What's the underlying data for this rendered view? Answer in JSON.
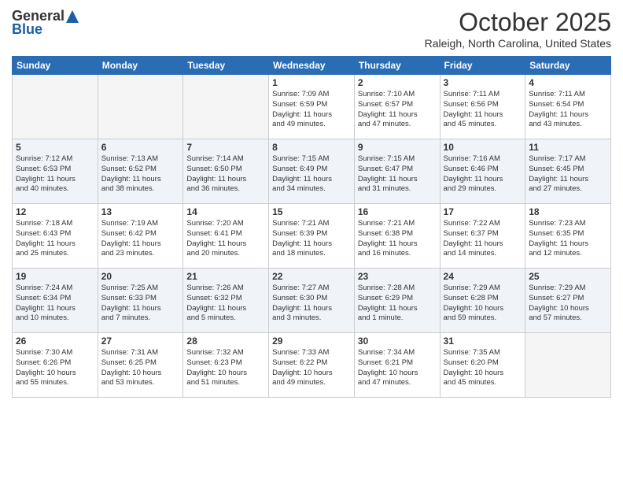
{
  "header": {
    "logo_general": "General",
    "logo_blue": "Blue",
    "month_title": "October 2025",
    "subtitle": "Raleigh, North Carolina, United States"
  },
  "days": [
    "Sunday",
    "Monday",
    "Tuesday",
    "Wednesday",
    "Thursday",
    "Friday",
    "Saturday"
  ],
  "weeks": [
    [
      {
        "date": "",
        "info": ""
      },
      {
        "date": "",
        "info": ""
      },
      {
        "date": "",
        "info": ""
      },
      {
        "date": "1",
        "info": "Sunrise: 7:09 AM\nSunset: 6:59 PM\nDaylight: 11 hours\nand 49 minutes."
      },
      {
        "date": "2",
        "info": "Sunrise: 7:10 AM\nSunset: 6:57 PM\nDaylight: 11 hours\nand 47 minutes."
      },
      {
        "date": "3",
        "info": "Sunrise: 7:11 AM\nSunset: 6:56 PM\nDaylight: 11 hours\nand 45 minutes."
      },
      {
        "date": "4",
        "info": "Sunrise: 7:11 AM\nSunset: 6:54 PM\nDaylight: 11 hours\nand 43 minutes."
      }
    ],
    [
      {
        "date": "5",
        "info": "Sunrise: 7:12 AM\nSunset: 6:53 PM\nDaylight: 11 hours\nand 40 minutes."
      },
      {
        "date": "6",
        "info": "Sunrise: 7:13 AM\nSunset: 6:52 PM\nDaylight: 11 hours\nand 38 minutes."
      },
      {
        "date": "7",
        "info": "Sunrise: 7:14 AM\nSunset: 6:50 PM\nDaylight: 11 hours\nand 36 minutes."
      },
      {
        "date": "8",
        "info": "Sunrise: 7:15 AM\nSunset: 6:49 PM\nDaylight: 11 hours\nand 34 minutes."
      },
      {
        "date": "9",
        "info": "Sunrise: 7:15 AM\nSunset: 6:47 PM\nDaylight: 11 hours\nand 31 minutes."
      },
      {
        "date": "10",
        "info": "Sunrise: 7:16 AM\nSunset: 6:46 PM\nDaylight: 11 hours\nand 29 minutes."
      },
      {
        "date": "11",
        "info": "Sunrise: 7:17 AM\nSunset: 6:45 PM\nDaylight: 11 hours\nand 27 minutes."
      }
    ],
    [
      {
        "date": "12",
        "info": "Sunrise: 7:18 AM\nSunset: 6:43 PM\nDaylight: 11 hours\nand 25 minutes."
      },
      {
        "date": "13",
        "info": "Sunrise: 7:19 AM\nSunset: 6:42 PM\nDaylight: 11 hours\nand 23 minutes."
      },
      {
        "date": "14",
        "info": "Sunrise: 7:20 AM\nSunset: 6:41 PM\nDaylight: 11 hours\nand 20 minutes."
      },
      {
        "date": "15",
        "info": "Sunrise: 7:21 AM\nSunset: 6:39 PM\nDaylight: 11 hours\nand 18 minutes."
      },
      {
        "date": "16",
        "info": "Sunrise: 7:21 AM\nSunset: 6:38 PM\nDaylight: 11 hours\nand 16 minutes."
      },
      {
        "date": "17",
        "info": "Sunrise: 7:22 AM\nSunset: 6:37 PM\nDaylight: 11 hours\nand 14 minutes."
      },
      {
        "date": "18",
        "info": "Sunrise: 7:23 AM\nSunset: 6:35 PM\nDaylight: 11 hours\nand 12 minutes."
      }
    ],
    [
      {
        "date": "19",
        "info": "Sunrise: 7:24 AM\nSunset: 6:34 PM\nDaylight: 11 hours\nand 10 minutes."
      },
      {
        "date": "20",
        "info": "Sunrise: 7:25 AM\nSunset: 6:33 PM\nDaylight: 11 hours\nand 7 minutes."
      },
      {
        "date": "21",
        "info": "Sunrise: 7:26 AM\nSunset: 6:32 PM\nDaylight: 11 hours\nand 5 minutes."
      },
      {
        "date": "22",
        "info": "Sunrise: 7:27 AM\nSunset: 6:30 PM\nDaylight: 11 hours\nand 3 minutes."
      },
      {
        "date": "23",
        "info": "Sunrise: 7:28 AM\nSunset: 6:29 PM\nDaylight: 11 hours\nand 1 minute."
      },
      {
        "date": "24",
        "info": "Sunrise: 7:29 AM\nSunset: 6:28 PM\nDaylight: 10 hours\nand 59 minutes."
      },
      {
        "date": "25",
        "info": "Sunrise: 7:29 AM\nSunset: 6:27 PM\nDaylight: 10 hours\nand 57 minutes."
      }
    ],
    [
      {
        "date": "26",
        "info": "Sunrise: 7:30 AM\nSunset: 6:26 PM\nDaylight: 10 hours\nand 55 minutes."
      },
      {
        "date": "27",
        "info": "Sunrise: 7:31 AM\nSunset: 6:25 PM\nDaylight: 10 hours\nand 53 minutes."
      },
      {
        "date": "28",
        "info": "Sunrise: 7:32 AM\nSunset: 6:23 PM\nDaylight: 10 hours\nand 51 minutes."
      },
      {
        "date": "29",
        "info": "Sunrise: 7:33 AM\nSunset: 6:22 PM\nDaylight: 10 hours\nand 49 minutes."
      },
      {
        "date": "30",
        "info": "Sunrise: 7:34 AM\nSunset: 6:21 PM\nDaylight: 10 hours\nand 47 minutes."
      },
      {
        "date": "31",
        "info": "Sunrise: 7:35 AM\nSunset: 6:20 PM\nDaylight: 10 hours\nand 45 minutes."
      },
      {
        "date": "",
        "info": ""
      }
    ]
  ]
}
